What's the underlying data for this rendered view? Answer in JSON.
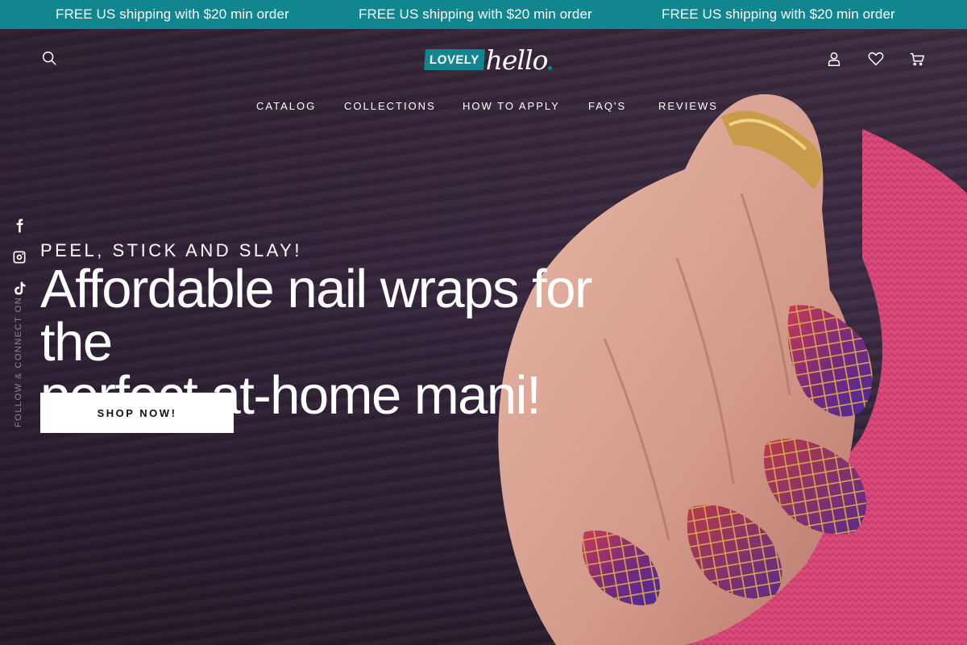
{
  "announcement": {
    "messages": [
      "FREE US shipping with $20 min order",
      "FREE US shipping with $20 min order",
      "FREE US shipping with $20 min order"
    ]
  },
  "header": {
    "logo": {
      "badge": "LOVELY",
      "script": "hello"
    },
    "icons": [
      "search-icon",
      "account-icon",
      "wishlist-icon",
      "cart-icon"
    ]
  },
  "nav": {
    "items": [
      {
        "label": "CATALOG"
      },
      {
        "label": "COLLECTIONS"
      },
      {
        "label": "HOW TO APPLY"
      },
      {
        "label": "FAQ'S"
      },
      {
        "label": "REVIEWS"
      }
    ]
  },
  "social": {
    "icons": [
      "facebook-icon",
      "instagram-icon",
      "tiktok-icon"
    ],
    "label": "FOLLOW & CONNECT ON"
  },
  "hero": {
    "eyebrow": "PEEL, STICK AND SLAY!",
    "headline_line1": "Affordable nail wraps for the",
    "headline_line2": "perfect at-home mani!",
    "cta_label": "SHOP NOW!"
  },
  "colors": {
    "brand": "#12868f",
    "hero_bg": "#3a2a3d",
    "sweater": "#d94a7a",
    "nail_polish_a": "#5a2a8a",
    "nail_polish_b": "#b83a5c",
    "nail_pattern": "#d9a64a"
  }
}
